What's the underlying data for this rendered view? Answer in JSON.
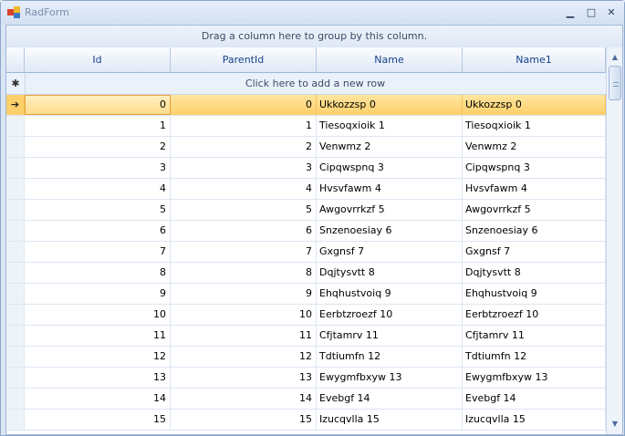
{
  "window": {
    "title": "RadForm",
    "minimize_glyph": "▁",
    "maximize_glyph": "□",
    "close_glyph": "✕"
  },
  "grid": {
    "group_panel_text": "Drag a column here to group by this column.",
    "columns": [
      "Id",
      "ParentId",
      "Name",
      "Name1"
    ],
    "new_row": {
      "indicator": "✱",
      "text": "Click here to add a new row"
    },
    "current_row_indicator": "➔",
    "selected_row_index": 0,
    "rows": [
      {
        "id": "0",
        "parent_id": "0",
        "name": "Ukkozzsp 0",
        "name1": "Ukkozzsp 0"
      },
      {
        "id": "1",
        "parent_id": "1",
        "name": "Tiesoqxioik 1",
        "name1": "Tiesoqxioik 1"
      },
      {
        "id": "2",
        "parent_id": "2",
        "name": "Venwmz 2",
        "name1": "Venwmz 2"
      },
      {
        "id": "3",
        "parent_id": "3",
        "name": "Cipqwspnq 3",
        "name1": "Cipqwspnq 3"
      },
      {
        "id": "4",
        "parent_id": "4",
        "name": "Hvsvfawm 4",
        "name1": "Hvsvfawm 4"
      },
      {
        "id": "5",
        "parent_id": "5",
        "name": "Awgovrrkzf 5",
        "name1": "Awgovrrkzf 5"
      },
      {
        "id": "6",
        "parent_id": "6",
        "name": "Snzenoesiay 6",
        "name1": "Snzenoesiay 6"
      },
      {
        "id": "7",
        "parent_id": "7",
        "name": "Gxgnsf 7",
        "name1": "Gxgnsf 7"
      },
      {
        "id": "8",
        "parent_id": "8",
        "name": "Dqjtysvtt 8",
        "name1": "Dqjtysvtt 8"
      },
      {
        "id": "9",
        "parent_id": "9",
        "name": "Ehqhustvoiq 9",
        "name1": "Ehqhustvoiq 9"
      },
      {
        "id": "10",
        "parent_id": "10",
        "name": "Eerbtzroezf 10",
        "name1": "Eerbtzroezf 10"
      },
      {
        "id": "11",
        "parent_id": "11",
        "name": "Cfjtamrv 11",
        "name1": "Cfjtamrv 11"
      },
      {
        "id": "12",
        "parent_id": "12",
        "name": "Tdtiumfn 12",
        "name1": "Tdtiumfn 12"
      },
      {
        "id": "13",
        "parent_id": "13",
        "name": "Ewygmfbxyw 13",
        "name1": "Ewygmfbxyw 13"
      },
      {
        "id": "14",
        "parent_id": "14",
        "name": "Evebgf 14",
        "name1": "Evebgf 14"
      },
      {
        "id": "15",
        "parent_id": "15",
        "name": "Izucqvlla 15",
        "name1": "Izucqvlla 15"
      }
    ]
  },
  "scrollbar": {
    "up_glyph": "▲",
    "down_glyph": "▼"
  },
  "colors": {
    "selected_row": "#fdcf6a",
    "header_text": "#15428b",
    "grid_border": "#9eb6d8"
  }
}
